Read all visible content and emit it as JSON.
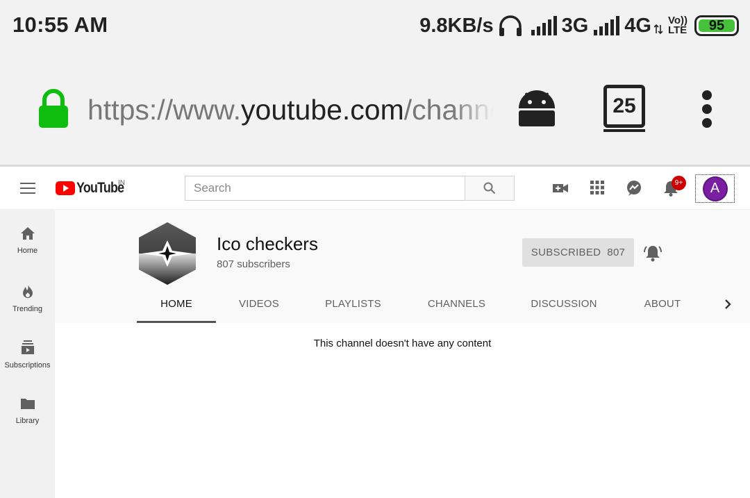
{
  "status_bar": {
    "time": "10:55 AM",
    "speed": "9.8KB/s",
    "net1": "3G",
    "net2": "4G",
    "volte_top": "Vo))",
    "volte_bottom": "LTE",
    "battery": "95",
    "battery_color": "#47c13c"
  },
  "browser": {
    "url_scheme": "https://www.",
    "url_host": "youtube.com",
    "url_path": "/channel",
    "tab_count": "25",
    "lock_color": "#0fbd0f"
  },
  "masthead": {
    "logo_text": "YouTube",
    "country": "IN",
    "search_placeholder": "Search",
    "notification_badge": "9+",
    "avatar_letter": "A",
    "avatar_color": "#7b1fa2",
    "brand_red": "#ff0000"
  },
  "guide": {
    "items": [
      {
        "label": "Home",
        "icon": "home-icon"
      },
      {
        "label": "Trending",
        "icon": "flame-icon"
      },
      {
        "label": "Subscriptions",
        "icon": "subscriptions-icon"
      },
      {
        "label": "Library",
        "icon": "folder-icon"
      }
    ]
  },
  "channel": {
    "name": "Ico checkers",
    "subscribers": "807 subscribers",
    "subscribe_label": "SUBSCRIBED",
    "subscribe_count": "807",
    "tabs": [
      "HOME",
      "VIDEOS",
      "PLAYLISTS",
      "CHANNELS",
      "DISCUSSION",
      "ABOUT"
    ],
    "active_tab": "HOME"
  },
  "content": {
    "empty_message": "This channel doesn't have any content"
  }
}
